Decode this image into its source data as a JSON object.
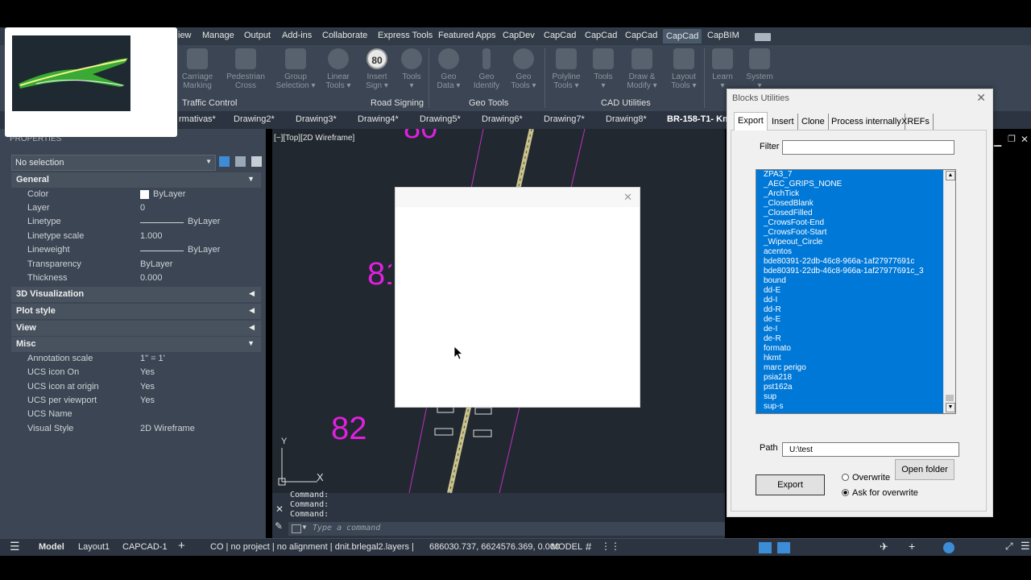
{
  "ribbon": {
    "tabs": [
      "iew",
      "Manage",
      "Output",
      "Add-ins",
      "Collaborate",
      "Express Tools",
      "Featured Apps",
      "CapDev",
      "CapCad",
      "CapCad",
      "CapCad",
      "CapCad",
      "CapBIM"
    ],
    "active_tab_index": 11,
    "buttons": [
      {
        "label": "Carriage\nMarking"
      },
      {
        "label": "Pedestrian\nCross"
      },
      {
        "label": "Group\nSelection ▾"
      },
      {
        "label": "Linear\nTools ▾"
      },
      {
        "label": "Insert\nSign ▾"
      },
      {
        "label": "Tools\n▾"
      },
      {
        "label": "Geo\nData ▾"
      },
      {
        "label": "Geo\nIdentify"
      },
      {
        "label": "Geo\nTools ▾"
      },
      {
        "label": "Polyline\nTools ▾"
      },
      {
        "label": "Tools\n▾"
      },
      {
        "label": "Draw &\nModify ▾"
      },
      {
        "label": "Layout\nTools ▾"
      },
      {
        "label": "Learn\n▾"
      },
      {
        "label": "System\n▾"
      }
    ],
    "sign_number": "80",
    "groups": [
      "Traffic Control",
      "Road Signing",
      "Geo Tools",
      "CAD Utilities"
    ]
  },
  "doc_tabs": [
    "rmativas*",
    "Drawing2*",
    "Drawing3*",
    "Drawing4*",
    "Drawing5*",
    "Drawing6*",
    "Drawing7*",
    "Drawing8*",
    "BR-158-T1- Km"
  ],
  "properties": {
    "header": "PROPERTIES",
    "selection": "No selection",
    "general_label": "General",
    "general": [
      {
        "k": "Color",
        "v": "ByLayer"
      },
      {
        "k": "Layer",
        "v": "0"
      },
      {
        "k": "Linetype",
        "v": "ByLayer"
      },
      {
        "k": "Linetype scale",
        "v": "1.000"
      },
      {
        "k": "Lineweight",
        "v": "ByLayer"
      },
      {
        "k": "Transparency",
        "v": "ByLayer"
      },
      {
        "k": "Thickness",
        "v": "0.000"
      }
    ],
    "sections": [
      "3D Visualization",
      "Plot style",
      "View"
    ],
    "misc_label": "Misc",
    "misc": [
      {
        "k": "Annotation scale",
        "v": "1\" = 1'"
      },
      {
        "k": "UCS icon On",
        "v": "Yes"
      },
      {
        "k": "UCS icon at origin",
        "v": "Yes"
      },
      {
        "k": "UCS per viewport",
        "v": "Yes"
      },
      {
        "k": "UCS Name",
        "v": ""
      },
      {
        "k": "Visual Style",
        "v": "2D Wireframe"
      }
    ]
  },
  "viewport": {
    "label": "[−][Top][2D Wireframe]",
    "station_81": "81",
    "station_82": "82",
    "station_top": "80",
    "axis_y": "Y",
    "axis_x": "X"
  },
  "command": {
    "lines": [
      "Command:",
      "Command:",
      "Command:"
    ],
    "placeholder": "Type a command"
  },
  "status": {
    "model": "Model",
    "layout1": "Layout1",
    "capcad": "CAPCAD-1",
    "plus": "+",
    "info": "CO | no project | no alignment | dnit.brlegal2.layers |",
    "coords": "686030.737, 6624576.369, 0.000",
    "space": "MODEL"
  },
  "blocks_dialog": {
    "title": "Blocks Utilities",
    "tabs": [
      "Export",
      "Insert",
      "Clone",
      "Process internally",
      "XREFs"
    ],
    "filter_label": "Filter",
    "filter_value": "",
    "items": [
      "ZPA3_7",
      "_AEC_GRIPS_NONE",
      "_ArchTick",
      "_ClosedBlank",
      "_ClosedFilled",
      "_CrowsFoot-End",
      "_CrowsFoot-Start",
      "_Wipeout_Circle",
      "acentos",
      "bde80391-22db-46c8-966a-1af27977691c",
      "bde80391-22db-46c8-966a-1af27977691c_3",
      "bound",
      "dd-E",
      "dd-I",
      "dd-R",
      "de-E",
      "de-I",
      "de-R",
      "formato",
      "hkmt",
      "marc perigo",
      "psia218",
      "pst162a",
      "sup",
      "sup-s"
    ],
    "path_label": "Path",
    "path_value": "U:\\test",
    "open_folder": "Open folder",
    "export_button": "Export",
    "overwrite": "Overwrite",
    "ask_overwrite": "Ask for overwrite",
    "selected_option": "ask"
  }
}
